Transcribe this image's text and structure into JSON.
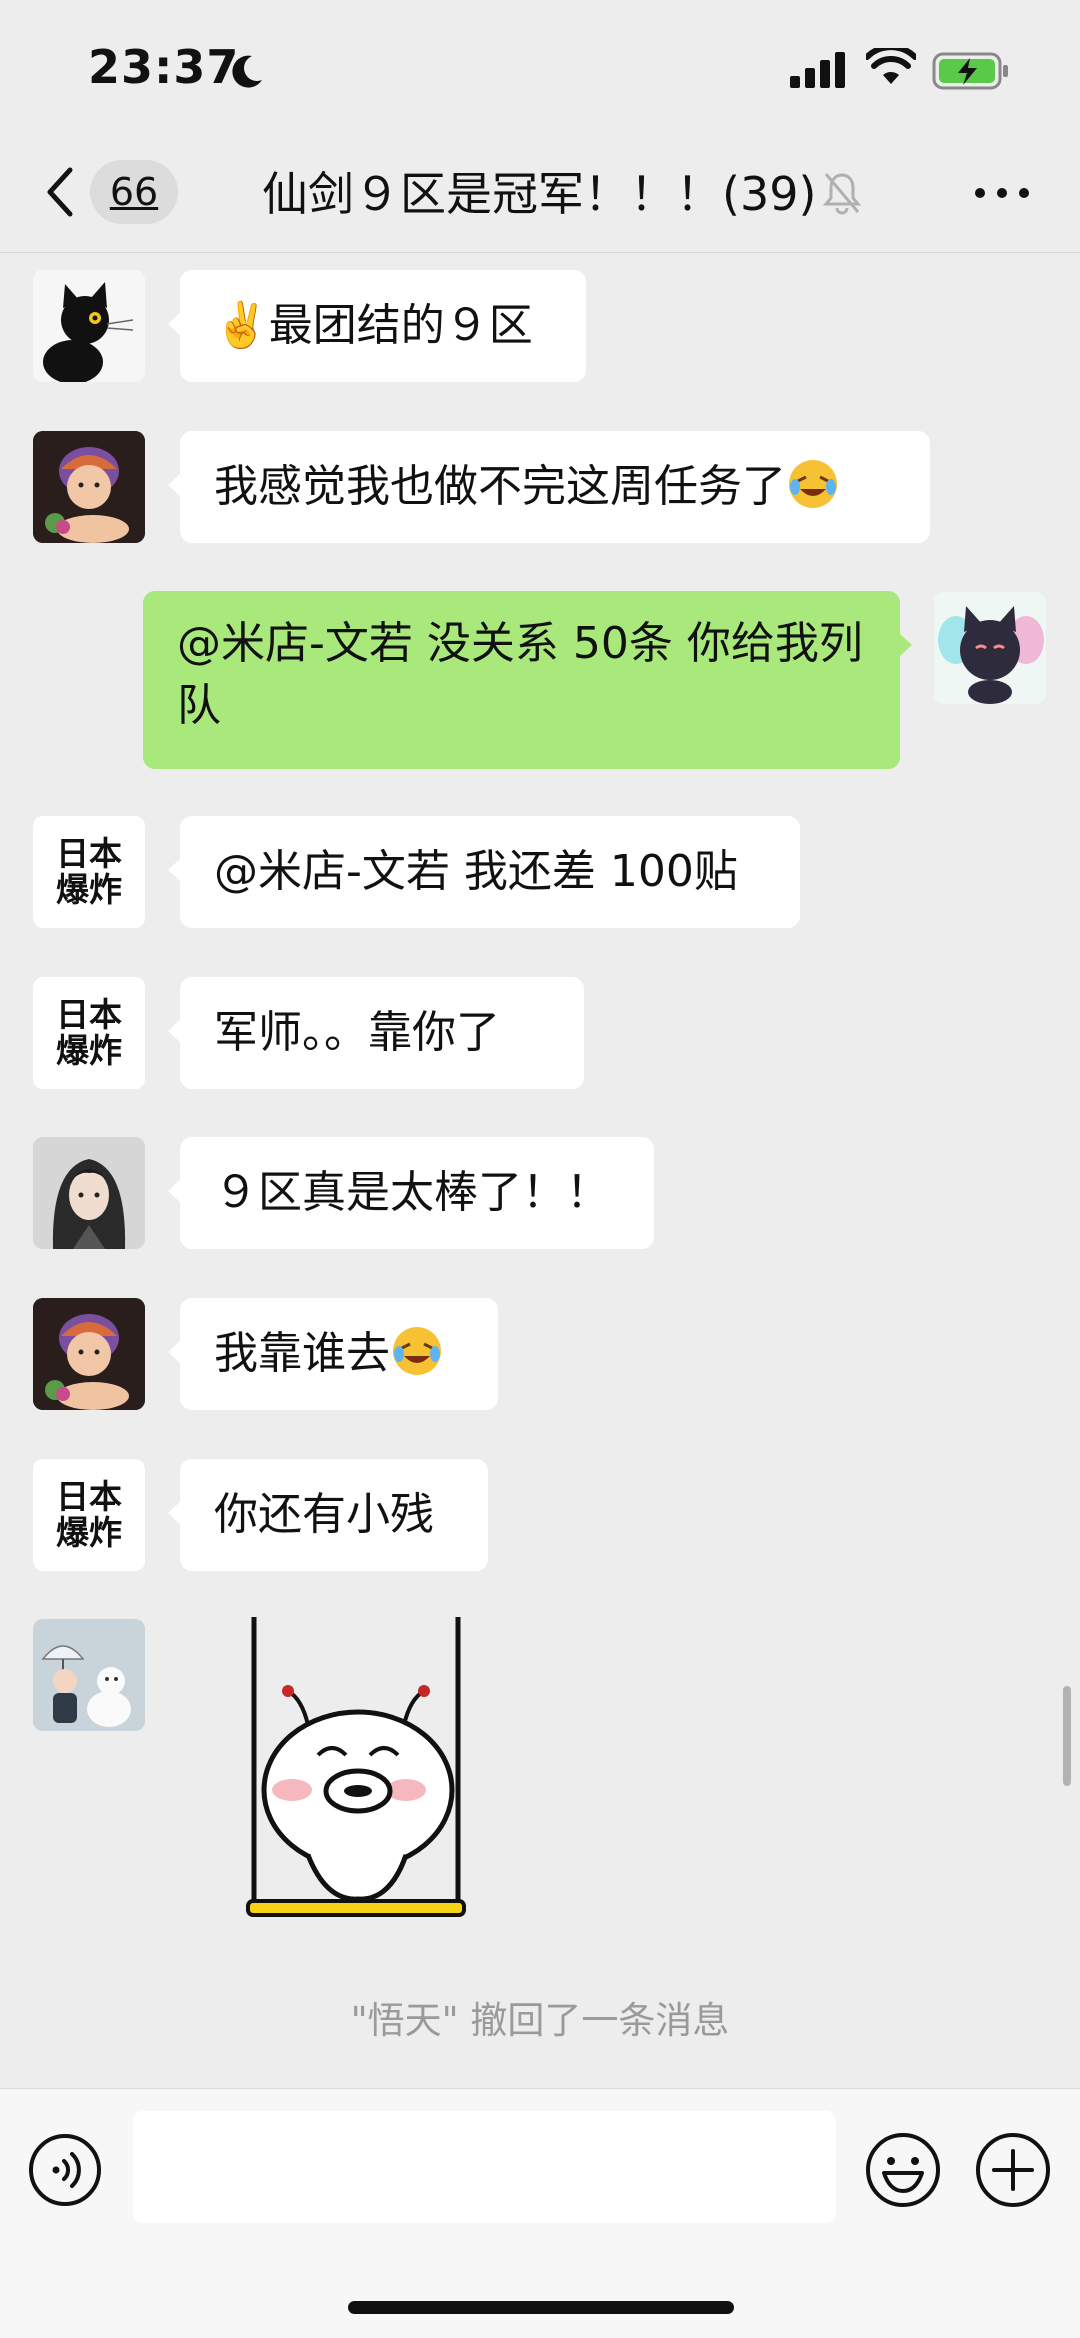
{
  "status": {
    "time": "23:37"
  },
  "nav": {
    "badge": "66",
    "title": "仙剑９区是冠军！！！(39)"
  },
  "messages": [
    {
      "text": "✌️最团结的９区"
    },
    {
      "text": "我感觉我也做不完这周任务了"
    },
    {
      "text": "@米店-文若 没关系 50条 你给我列队"
    },
    {
      "text": "@米店-文若 我还差 100贴"
    },
    {
      "text": "军师。。靠你了"
    },
    {
      "text": "９区真是太棒了！！"
    },
    {
      "text": "我靠谁去"
    },
    {
      "text": "你还有小残"
    }
  ],
  "avatar_label": {
    "line1": "日本",
    "line2": "爆炸"
  },
  "system": {
    "recall": "\"悟天\" 撤回了一条消息"
  },
  "input": {
    "placeholder": ""
  }
}
